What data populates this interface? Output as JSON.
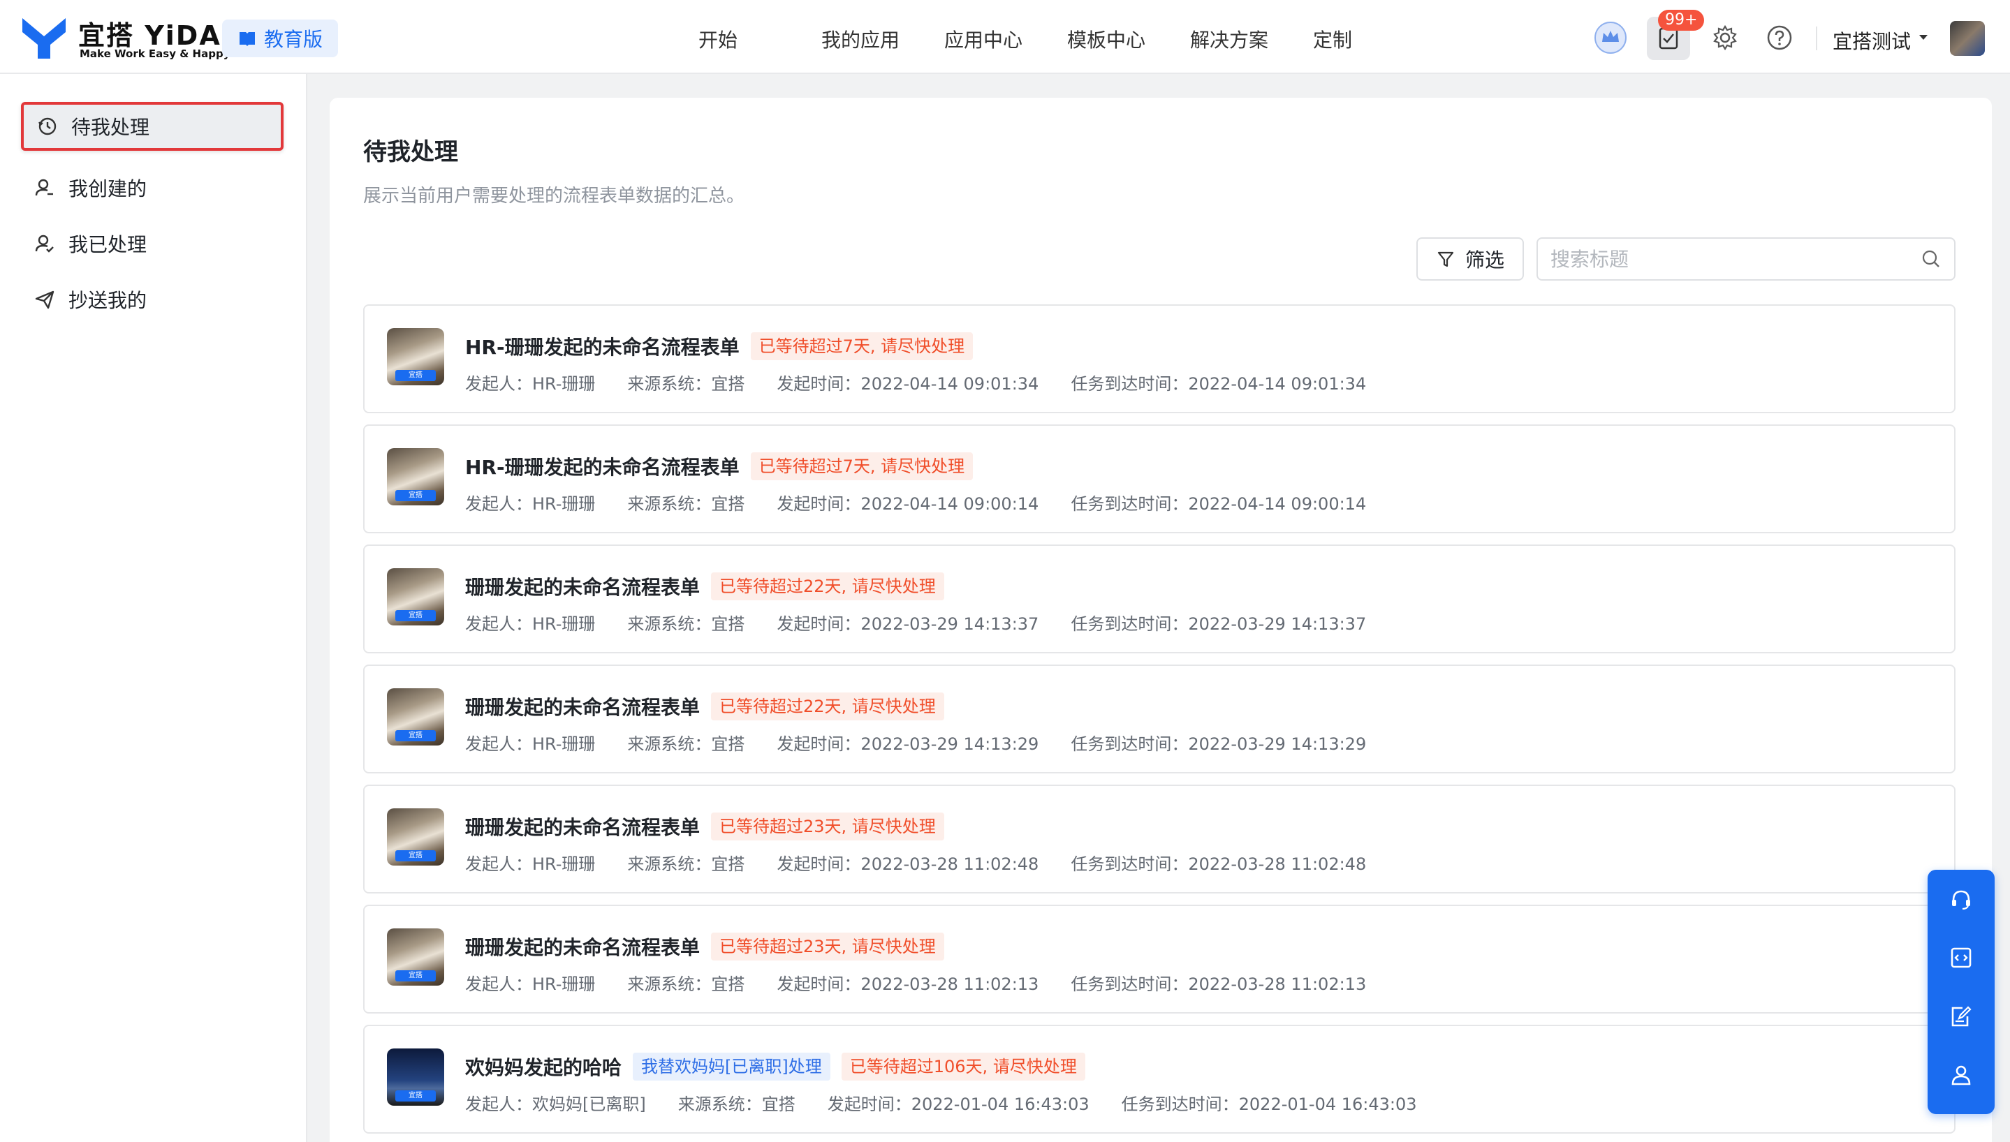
{
  "brand": {
    "name": "宜搭 YiDA",
    "slogan": "Make Work Easy & Happy",
    "edition": "教育版"
  },
  "nav": {
    "items": [
      "开始",
      "我的应用",
      "应用中心",
      "模板中心",
      "解决方案",
      "定制"
    ]
  },
  "topbar": {
    "task_badge": "99+",
    "user_name": "宜搭测试"
  },
  "sidebar": {
    "items": [
      {
        "label": "待我处理",
        "icon": "clock-icon",
        "active": true
      },
      {
        "label": "我创建的",
        "icon": "user-add-icon",
        "active": false
      },
      {
        "label": "我已处理",
        "icon": "user-check-icon",
        "active": false
      },
      {
        "label": "抄送我的",
        "icon": "send-icon",
        "active": false
      }
    ]
  },
  "main": {
    "title": "待我处理",
    "description": "展示当前用户需要处理的流程表单数据的汇总。",
    "filter_label": "筛选",
    "search_placeholder": "搜索标题"
  },
  "tasks": [
    {
      "title": "HR-珊珊发起的未命名流程表单",
      "tags": [
        {
          "text": "已等待超过7天, 请尽快处理",
          "type": "warn"
        }
      ],
      "initiator": "发起人：HR-珊珊",
      "source": "来源系统：宜搭",
      "start_time": "发起时间：2022-04-14 09:01:34",
      "arrive_time": "任务到达时间：2022-04-14 09:01:34",
      "avatar": "photo"
    },
    {
      "title": "HR-珊珊发起的未命名流程表单",
      "tags": [
        {
          "text": "已等待超过7天, 请尽快处理",
          "type": "warn"
        }
      ],
      "initiator": "发起人：HR-珊珊",
      "source": "来源系统：宜搭",
      "start_time": "发起时间：2022-04-14 09:00:14",
      "arrive_time": "任务到达时间：2022-04-14 09:00:14",
      "avatar": "photo"
    },
    {
      "title": "珊珊发起的未命名流程表单",
      "tags": [
        {
          "text": "已等待超过22天, 请尽快处理",
          "type": "warn"
        }
      ],
      "initiator": "发起人：HR-珊珊",
      "source": "来源系统：宜搭",
      "start_time": "发起时间：2022-03-29 14:13:37",
      "arrive_time": "任务到达时间：2022-03-29 14:13:37",
      "avatar": "photo"
    },
    {
      "title": "珊珊发起的未命名流程表单",
      "tags": [
        {
          "text": "已等待超过22天, 请尽快处理",
          "type": "warn"
        }
      ],
      "initiator": "发起人：HR-珊珊",
      "source": "来源系统：宜搭",
      "start_time": "发起时间：2022-03-29 14:13:29",
      "arrive_time": "任务到达时间：2022-03-29 14:13:29",
      "avatar": "photo"
    },
    {
      "title": "珊珊发起的未命名流程表单",
      "tags": [
        {
          "text": "已等待超过23天, 请尽快处理",
          "type": "warn"
        }
      ],
      "initiator": "发起人：HR-珊珊",
      "source": "来源系统：宜搭",
      "start_time": "发起时间：2022-03-28 11:02:48",
      "arrive_time": "任务到达时间：2022-03-28 11:02:48",
      "avatar": "photo"
    },
    {
      "title": "珊珊发起的未命名流程表单",
      "tags": [
        {
          "text": "已等待超过23天, 请尽快处理",
          "type": "warn"
        }
      ],
      "initiator": "发起人：HR-珊珊",
      "source": "来源系统：宜搭",
      "start_time": "发起时间：2022-03-28 11:02:13",
      "arrive_time": "任务到达时间：2022-03-28 11:02:13",
      "avatar": "photo"
    },
    {
      "title": "欢妈妈发起的哈哈",
      "tags": [
        {
          "text": "我替欢妈妈[已离职]处理",
          "type": "info"
        },
        {
          "text": "已等待超过106天, 请尽快处理",
          "type": "warn"
        }
      ],
      "initiator": "发起人：欢妈妈[已离职]",
      "source": "来源系统：宜搭",
      "start_time": "发起时间：2022-01-04 16:43:03",
      "arrive_time": "任务到达时间：2022-01-04 16:43:03",
      "avatar": "night"
    }
  ],
  "avatar_tag": "宜搭",
  "float_toolbar": [
    "headset-icon",
    "code-icon",
    "edit-note-icon",
    "contacts-icon"
  ]
}
